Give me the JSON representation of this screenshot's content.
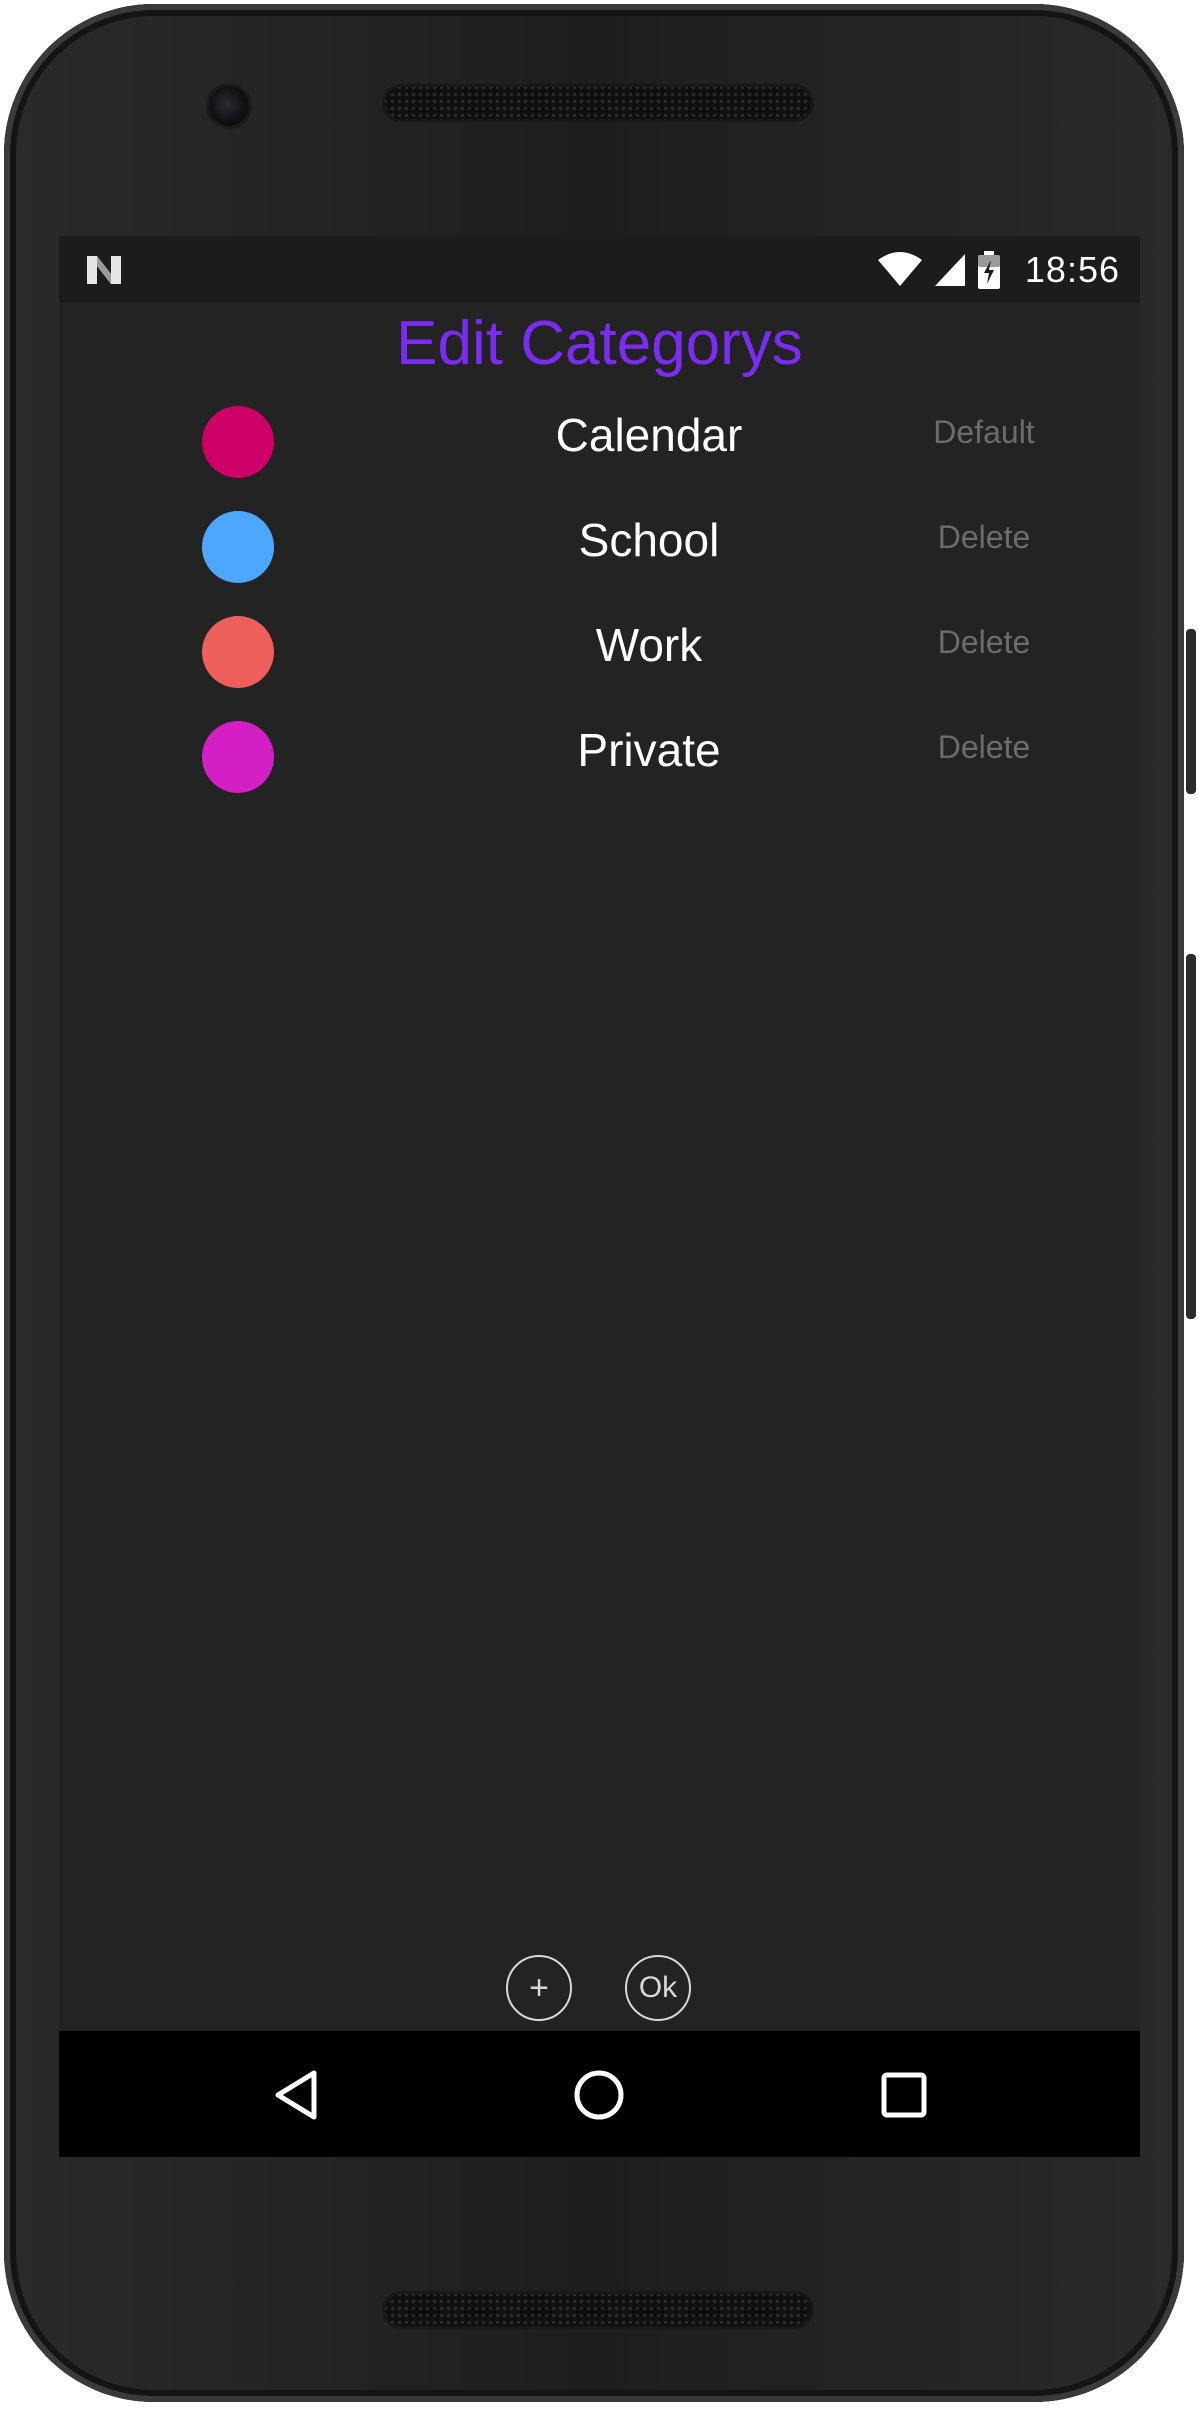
{
  "status_bar": {
    "time": "18:56",
    "icons": [
      "n-logo-icon",
      "wifi-icon",
      "signal-icon",
      "battery-charging-icon"
    ]
  },
  "screen": {
    "title": "Edit Categorys",
    "title_color": "#7b2cf2",
    "categories": [
      {
        "name": "Calendar",
        "action": "Default",
        "color": "#cc0066"
      },
      {
        "name": "School",
        "action": "Delete",
        "color": "#4da6ff"
      },
      {
        "name": "Work",
        "action": "Delete",
        "color": "#ee5f5b"
      },
      {
        "name": "Private",
        "action": "Delete",
        "color": "#d41fc4"
      }
    ],
    "add_button": "+",
    "ok_button": "Ok"
  },
  "nav_bar": {
    "icons": [
      "back-icon",
      "home-icon",
      "recents-icon"
    ]
  }
}
